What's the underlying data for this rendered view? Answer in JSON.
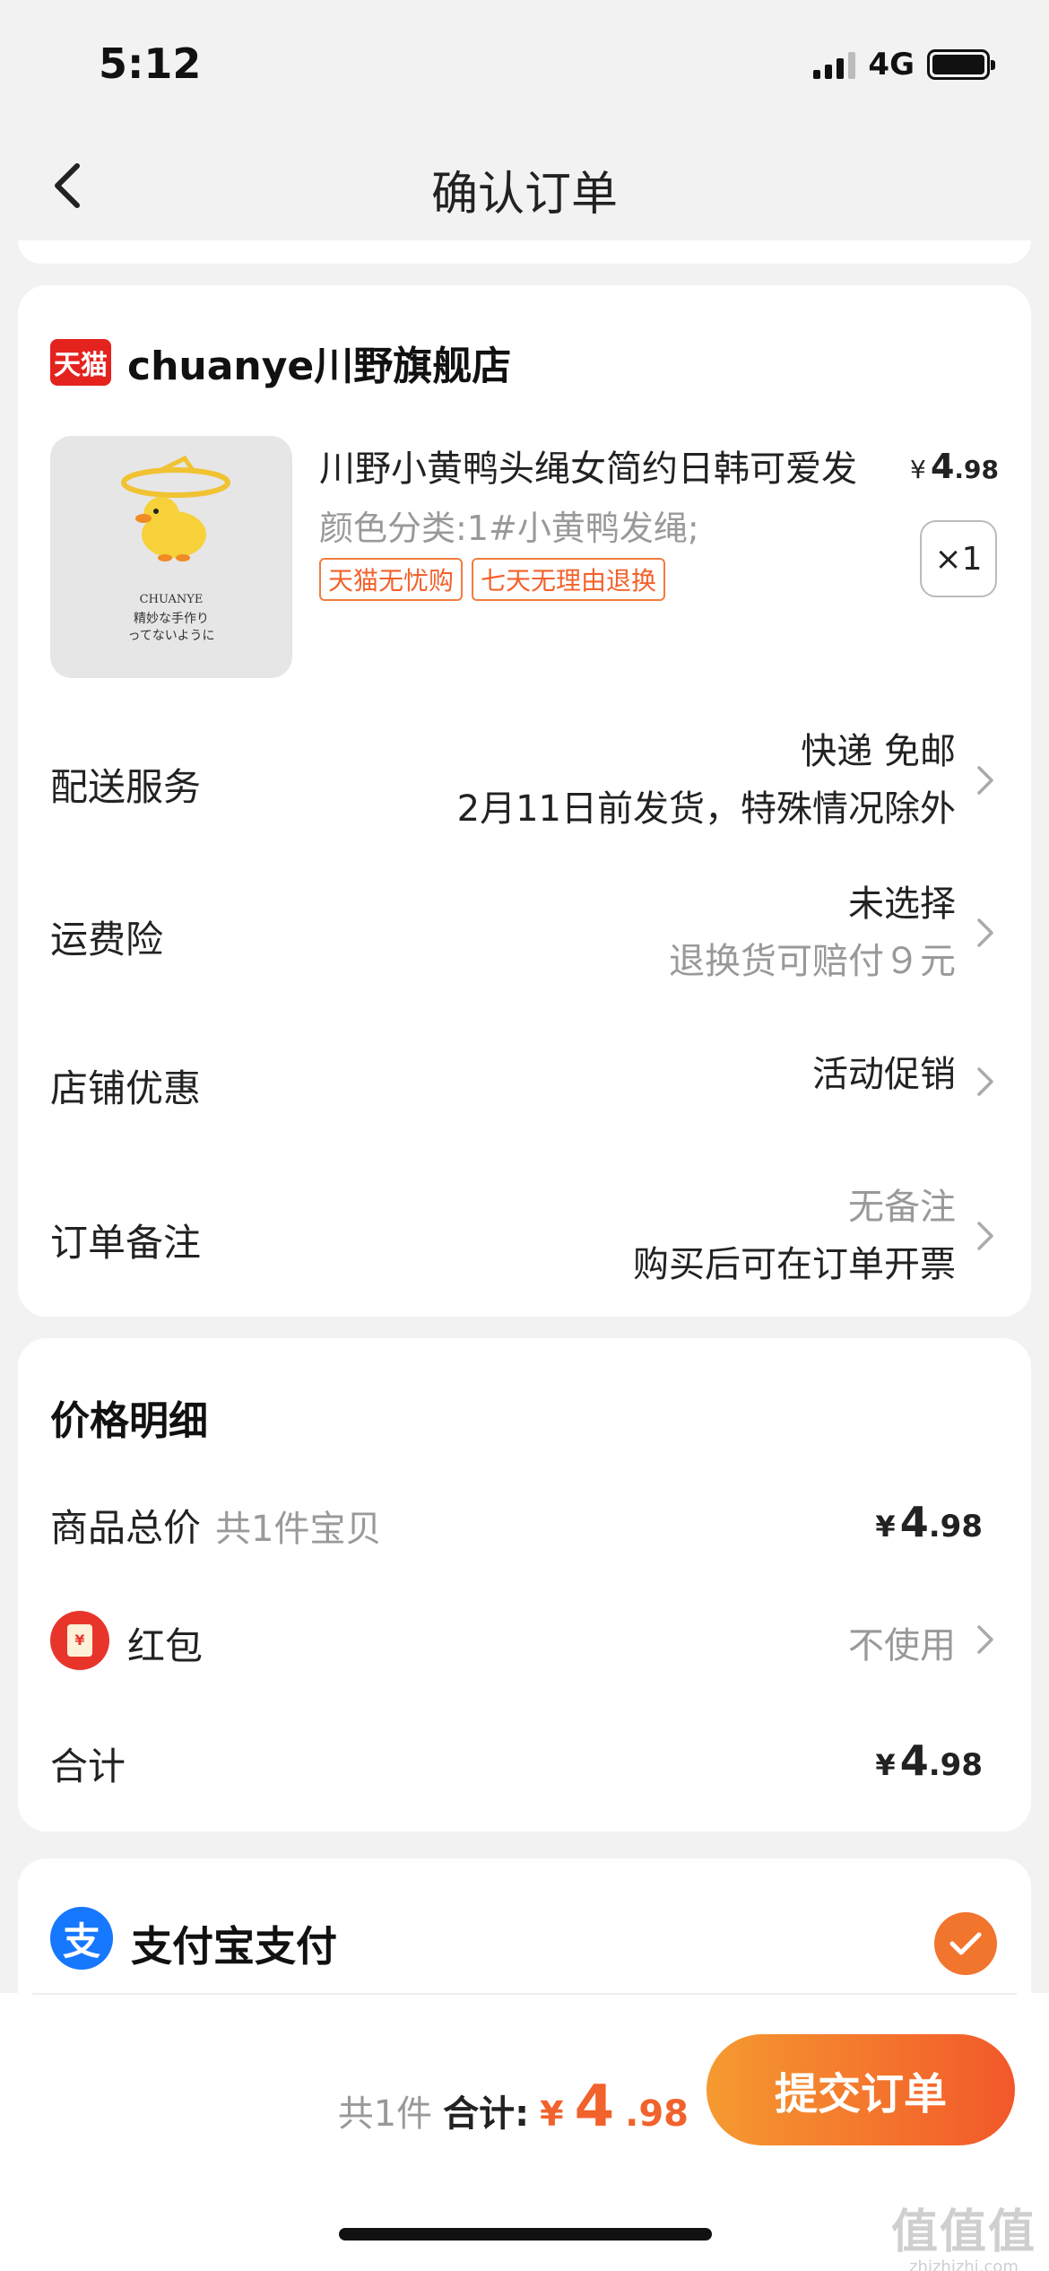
{
  "status": {
    "time": "5:12",
    "network": "4G"
  },
  "nav": {
    "title": "确认订单"
  },
  "shop": {
    "badge": "天猫",
    "name": "chuanye川野旗舰店",
    "product": {
      "image_lines": [
        "CHUANYE",
        "精妙な手作り",
        "ってないように"
      ],
      "title": "川野小黄鸭头绳女简约日韩可爱发",
      "price": {
        "currency": "¥",
        "integer": "4",
        "decimal": ".98"
      },
      "spec": "颜色分类:1#小黄鸭发绳;",
      "tags": [
        "天猫无忧购",
        "七天无理由退换"
      ],
      "quantity": "×1"
    },
    "rows": {
      "delivery": {
        "label": "配送服务",
        "line1": "快递 免邮",
        "line2": "2月11日前发货，特殊情况除外"
      },
      "insurance": {
        "label": "运费险",
        "line1": "未选择",
        "line2": "退换货可赔付９元"
      },
      "discount": {
        "label": "店铺优惠",
        "line1": "活动促销"
      },
      "note": {
        "label": "订单备注",
        "line1": "无备注",
        "line2": "购买后可在订单开票"
      }
    }
  },
  "price_detail": {
    "title": "价格明细",
    "goods_total": {
      "label": "商品总价",
      "sub": "共1件宝贝",
      "currency": "¥",
      "integer": "4",
      "decimal": ".98"
    },
    "hongbao": {
      "label": "红包",
      "icon_text": "¥",
      "value": "不使用"
    },
    "total": {
      "label": "合计",
      "currency": "¥",
      "integer": "4",
      "decimal": ".98"
    }
  },
  "payment": {
    "method": "支付宝支付",
    "icon_text": "支"
  },
  "bottom": {
    "count": "共1件",
    "total_label": "合计:",
    "currency": "¥",
    "integer": "4",
    "decimal": ".98",
    "submit": "提交订单"
  },
  "watermark": {
    "big": "值值值",
    "small": "zhizhizhi.com"
  },
  "colors": {
    "accent": "#f2622c",
    "tmall": "#e4231f",
    "alipay": "#1677ff"
  }
}
